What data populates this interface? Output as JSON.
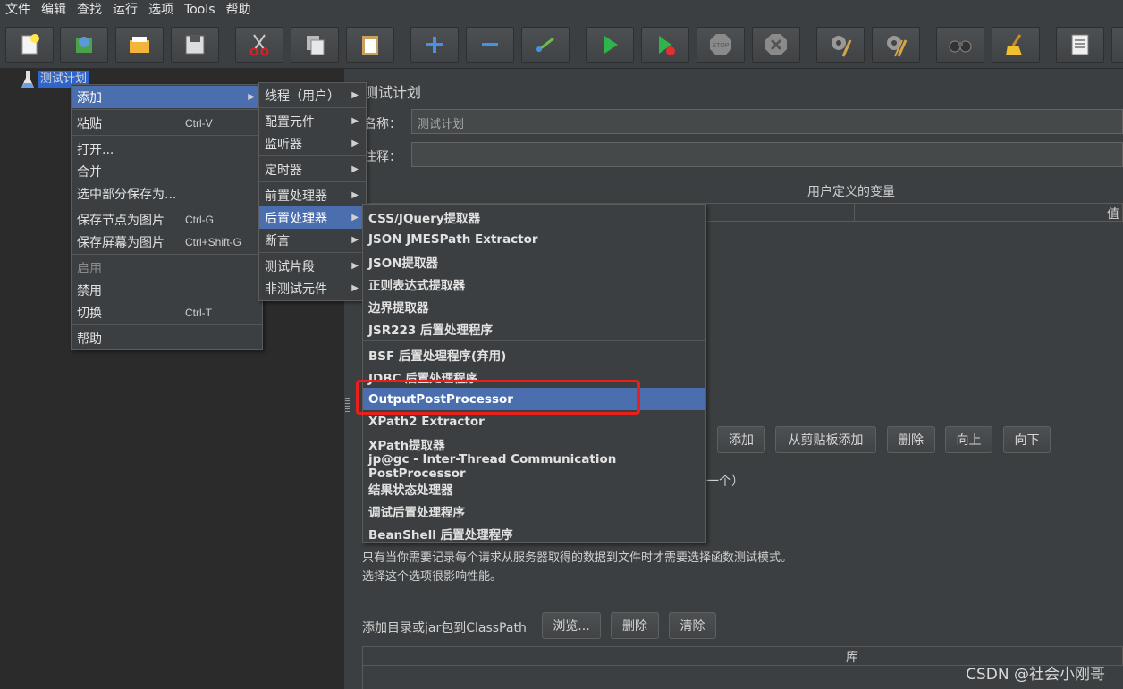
{
  "menubar": [
    "文件",
    "编辑",
    "查找",
    "运行",
    "选项",
    "Tools",
    "帮助"
  ],
  "toolbar_icons": [
    "new-icon",
    "templates-icon",
    "open-icon",
    "save-icon",
    "cut-icon",
    "copy-icon",
    "paste-icon",
    "expand-icon",
    "collapse-icon",
    "toggle-icon",
    "start-icon",
    "start-no-pause-icon",
    "stop-icon",
    "shutdown-icon",
    "clear-icon",
    "clear-all-icon",
    "search-icon",
    "reset-search-icon",
    "function-helper-icon"
  ],
  "tree": {
    "root_label": "测试计划"
  },
  "context_menu": {
    "items": [
      {
        "label": "添加",
        "shortcut": "",
        "submenu": true,
        "state": "selected"
      },
      {
        "label": "粘贴",
        "shortcut": "Ctrl-V"
      },
      {
        "label": "打开...",
        "shortcut": ""
      },
      {
        "label": "合并",
        "shortcut": ""
      },
      {
        "label": "选中部分保存为...",
        "shortcut": ""
      },
      {
        "label": "保存节点为图片",
        "shortcut": "Ctrl-G"
      },
      {
        "label": "保存屏幕为图片",
        "shortcut": "Ctrl+Shift-G"
      },
      {
        "label": "启用",
        "shortcut": "",
        "state": "disabled"
      },
      {
        "label": "禁用",
        "shortcut": ""
      },
      {
        "label": "切换",
        "shortcut": "Ctrl-T"
      },
      {
        "label": "帮助",
        "shortcut": ""
      }
    ]
  },
  "add_submenu": {
    "items": [
      {
        "label": "线程（用户）"
      },
      {
        "label": "配置元件"
      },
      {
        "label": "监听器"
      },
      {
        "label": "定时器"
      },
      {
        "label": "前置处理器"
      },
      {
        "label": "后置处理器",
        "state": "selected"
      },
      {
        "label": "断言"
      },
      {
        "label": "测试片段"
      },
      {
        "label": "非测试元件"
      }
    ]
  },
  "postprocessor_submenu": {
    "items": [
      {
        "label": "CSS/JQuery提取器"
      },
      {
        "label": "JSON JMESPath Extractor"
      },
      {
        "label": "JSON提取器"
      },
      {
        "label": "正则表达式提取器"
      },
      {
        "label": "边界提取器"
      },
      {
        "label": "JSR223 后置处理程序"
      },
      {
        "label": "BSF 后置处理程序(弃用)"
      },
      {
        "label": "JDBC 后置处理程序"
      },
      {
        "label": "OutputPostProcessor",
        "state": "selected"
      },
      {
        "label": "XPath2 Extractor"
      },
      {
        "label": "XPath提取器"
      },
      {
        "label": "jp@gc - Inter-Thread Communication PostProcessor"
      },
      {
        "label": "结果状态处理器"
      },
      {
        "label": "调试后置处理程序"
      },
      {
        "label": "BeanShell 后置处理程序"
      }
    ]
  },
  "panel": {
    "title": "测试计划",
    "name_label": "名称：",
    "name_value": "测试计划",
    "comment_label": "注释：",
    "comment_value": "",
    "vars_title": "用户定义的变量",
    "vars_col_value": "值",
    "buttons": [
      "添加",
      "从剪贴板添加",
      "删除",
      "向上",
      "向下"
    ],
    "partial_text": "一个）",
    "functional_note_1": "只有当你需要记录每个请求从服务器取得的数据到文件时才需要选择函数测试模式。",
    "functional_note_2": "选择这个选项很影响性能。",
    "classpath_label": "添加目录或jar包到ClassPath",
    "classpath_buttons": [
      "浏览...",
      "删除",
      "清除"
    ],
    "lib_col": "库"
  },
  "watermark": "CSDN @社会小刚哥",
  "colors": {
    "selection": "#4b6eaf",
    "highlight_box": "#e8201c",
    "background": "#3c3f41"
  }
}
